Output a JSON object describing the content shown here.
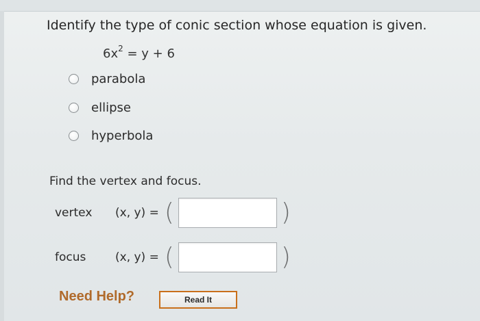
{
  "question": {
    "prompt": "Identify the type of conic section whose equation is given.",
    "equation": {
      "lhs_base": "6x",
      "lhs_exponent": "2",
      "rest": " = y + 6"
    },
    "options": [
      {
        "label": "parabola"
      },
      {
        "label": "ellipse"
      },
      {
        "label": "hyperbola"
      }
    ]
  },
  "subquestion": {
    "prompt": "Find the vertex and focus.",
    "rows": [
      {
        "label": "vertex",
        "expr": "(x, y) =",
        "open_paren": "(",
        "close_paren": ")",
        "value": ""
      },
      {
        "label": "focus",
        "expr": "(x, y) =",
        "open_paren": "(",
        "close_paren": ")",
        "value": ""
      }
    ]
  },
  "help": {
    "need_help": "Need Help?",
    "read_it": "Read It"
  },
  "colors": {
    "help_text": "#b06a2a",
    "button_border": "#c96f1a"
  }
}
